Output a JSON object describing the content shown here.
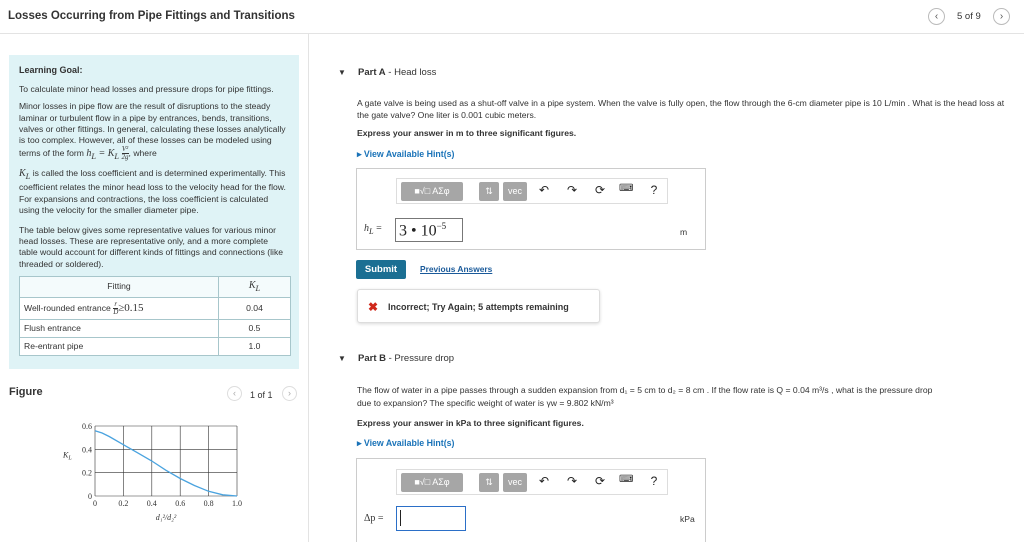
{
  "header": {
    "title": "Losses Occurring from Pipe Fittings and Transitions",
    "prev_icon": "chevron-left-icon",
    "next_icon": "chevron-right-icon",
    "page_count": "5 of 9"
  },
  "learning_goal": {
    "heading": "Learning Goal:",
    "p1": "To calculate minor head losses and pressure drops for pipe fittings.",
    "p2": "Minor losses in pipe flow are the result of disruptions to the steady laminar or turbulent flow in a pipe by entrances, bends, transitions, valves or other fittings. In general, calculating these losses analytically is too complex. However, all of these losses can be modeled using terms of the form",
    "formula_lhs": "h",
    "formula_lhs_sub": "L",
    "formula_eq": " = K",
    "formula_k_sub": "L",
    "formula_num": "V²",
    "formula_den": "2g",
    "formula_after": ", where",
    "p3_k": "K",
    "p3_k_sub": "L",
    "p3": " is called the loss coefficient and is determined experimentally. This coefficient relates the minor head loss to the velocity head for the flow. For expansions and contractions, the loss coefficient is calculated using the velocity for the smaller diameter pipe.",
    "p4": "The table below gives some representative values for various minor head losses. These are representative only, and a more complete table would account for different kinds of fittings and connections (like threaded or soldered).",
    "table": {
      "col_fitting": "Fitting",
      "col_k": "K",
      "col_k_sub": "L",
      "rows": [
        {
          "fitting": "Well-rounded entrance",
          "condition_num": "r",
          "condition_den": "D",
          "condition_rest": "≥0.15",
          "k": "0.04"
        },
        {
          "fitting": "Flush entrance",
          "k": "0.5"
        },
        {
          "fitting": "Re-entrant pipe",
          "k": "1.0"
        }
      ]
    }
  },
  "figure": {
    "label": "Figure",
    "count": "1 of 1",
    "prev_icon": "chevron-left-icon",
    "next_icon": "chevron-right-icon"
  },
  "chart_data": {
    "type": "line",
    "ylabel": "K",
    "ylabel_sub": "L",
    "xlabel": "d₁²/d₂²",
    "xlim": [
      0,
      1.0
    ],
    "ylim": [
      0,
      0.6
    ],
    "xticks": [
      "0",
      "0.2",
      "0.4",
      "0.6",
      "0.8",
      "1.0"
    ],
    "yticks": [
      "0",
      "0.2",
      "0.4",
      "0.6"
    ],
    "grid": true,
    "series": [
      {
        "color": "#4aa3df",
        "x": [
          0,
          0.05,
          0.1,
          0.2,
          0.3,
          0.4,
          0.5,
          0.6,
          0.7,
          0.8,
          0.9,
          1.0
        ],
        "y": [
          0.56,
          0.54,
          0.51,
          0.44,
          0.37,
          0.3,
          0.22,
          0.15,
          0.09,
          0.04,
          0.01,
          0.0
        ]
      }
    ]
  },
  "part_a": {
    "toggle_icon": "triangle-down-icon",
    "label": "Part A",
    "title": " - Head loss",
    "question": "A gate valve is being used as a shut-off valve in a pipe system. When the valve is fully open, the flow through the 6-cm diameter pipe is 10  L/min . What is the head loss at the gate valve? One liter is 0.001 cubic meters.",
    "express": "Express your answer in m to three significant figures.",
    "hint": "▸ View Available Hint(s)",
    "answer_label": "h",
    "answer_label_sub": "L",
    "answer_eq": " =",
    "answer_value": "3 • 10",
    "answer_exp": "−5",
    "unit": "m",
    "submit": "Submit",
    "previous_answers": "Previous Answers",
    "feedback_icon": "x-icon",
    "feedback": "Incorrect; Try Again; 5 attempts remaining"
  },
  "part_b": {
    "toggle_icon": "triangle-down-icon",
    "label": "Part B",
    "title": " - Pressure drop",
    "question_1": "The flow of water in a pipe passes through a sudden expansion from d₁ = 5  cm to d₂ = 8  cm . If the flow rate is Q = 0.04  m³/s , what is the pressure drop",
    "question_2": "due to expansion? The specific weight of water is γw = 9.802  kN/m³",
    "express": "Express your answer in kPa to three significant figures.",
    "hint": "▸ View Available Hint(s)",
    "answer_label": "Δp =",
    "answer_value": "",
    "unit": "kPa"
  },
  "toolbar": {
    "templates_icon": "templates-icon",
    "symbols_label": "ΑΣφ",
    "arrows_icon": "up-down-arrows-icon",
    "vec_label": "vec",
    "undo_icon": "undo-icon",
    "redo_icon": "redo-icon",
    "reset_icon": "reset-icon",
    "keyboard_icon": "keyboard-icon",
    "help_label": "?"
  }
}
